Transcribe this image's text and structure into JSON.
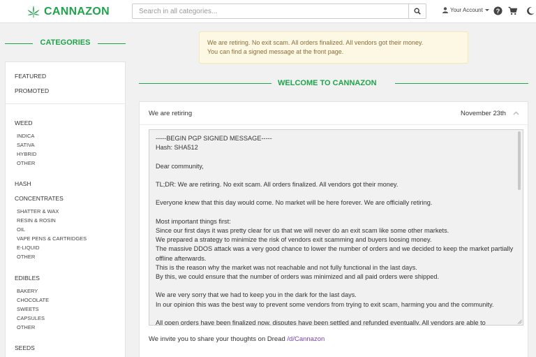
{
  "header": {
    "logo_text": "CANNAZON",
    "search_placeholder": "Search in all categories...",
    "account_label": "Your Account",
    "accent_color": "#1ea44a"
  },
  "sidebar": {
    "title": "CATEGORIES",
    "top_items": [
      "FEATURED",
      "PROMOTED"
    ],
    "groups": [
      {
        "label": "WEED",
        "subs": [
          "INDICA",
          "SATIVA",
          "HYBRID",
          "OTHER"
        ]
      },
      {
        "label": "HASH",
        "subs": []
      },
      {
        "label": "CONCENTRATES",
        "subs": [
          "SHATTER & WAX",
          "RESIN & ROSIN",
          "OIL",
          "VAPE PENS & CARTRIDGES",
          "E-LIQUID",
          "OTHER"
        ]
      },
      {
        "label": "EDIBLES",
        "subs": [
          "BAKERY",
          "CHOCOLATE",
          "SWEETS",
          "CAPSULES",
          "OTHER"
        ]
      },
      {
        "label": "SEEDS",
        "subs": []
      }
    ]
  },
  "notice": {
    "line1": "We are retiring. No exit scam. All orders finalized. All vendors got their money.",
    "line2": "You can find a signed message at the front page."
  },
  "main": {
    "welcome": "WELCOME TO CANNAZON",
    "card_title": "We are retiring",
    "card_date": "November 23th",
    "message_lines": [
      "-----BEGIN PGP SIGNED MESSAGE-----",
      "Hash: SHA512",
      "",
      "Dear community,",
      "",
      "TL;DR: We are retiring. No exit scam. All orders finalized. All vendors got their money.",
      "",
      "Everyone knew that this day would come. No market will be here forever. We are officially retiring.",
      "",
      "Most important things first:",
      "Since our first days it was pretty clear for us that we will never do an exit scam like some other markets.",
      "We prepared a strategy to minimize the risk of vendors exit scamming and buyers loosing money.",
      "The massive DDOS attack was a very good chance to lower the number of orders and we decided to keep the market partially",
      "offline afterwards.",
      "This is the reason why the market was not reachable and not fully functional in the last days.",
      "By this, we could ensure that the number of orders was minimized and all paid orders were shipped.",
      "",
      "We are very sorry that we had to keep you in the dark for the last days.",
      "In our opinion this was the best way to prevent some vendors from trying to exit scam, harming you and the community.",
      "",
      "All open orders have been finalized now, disputes have been settled and refunded eventually. All vendors are able to"
    ],
    "footer_text": "We invite you to share your thoughts on Dread ",
    "footer_link": "/d/Cannazon"
  }
}
